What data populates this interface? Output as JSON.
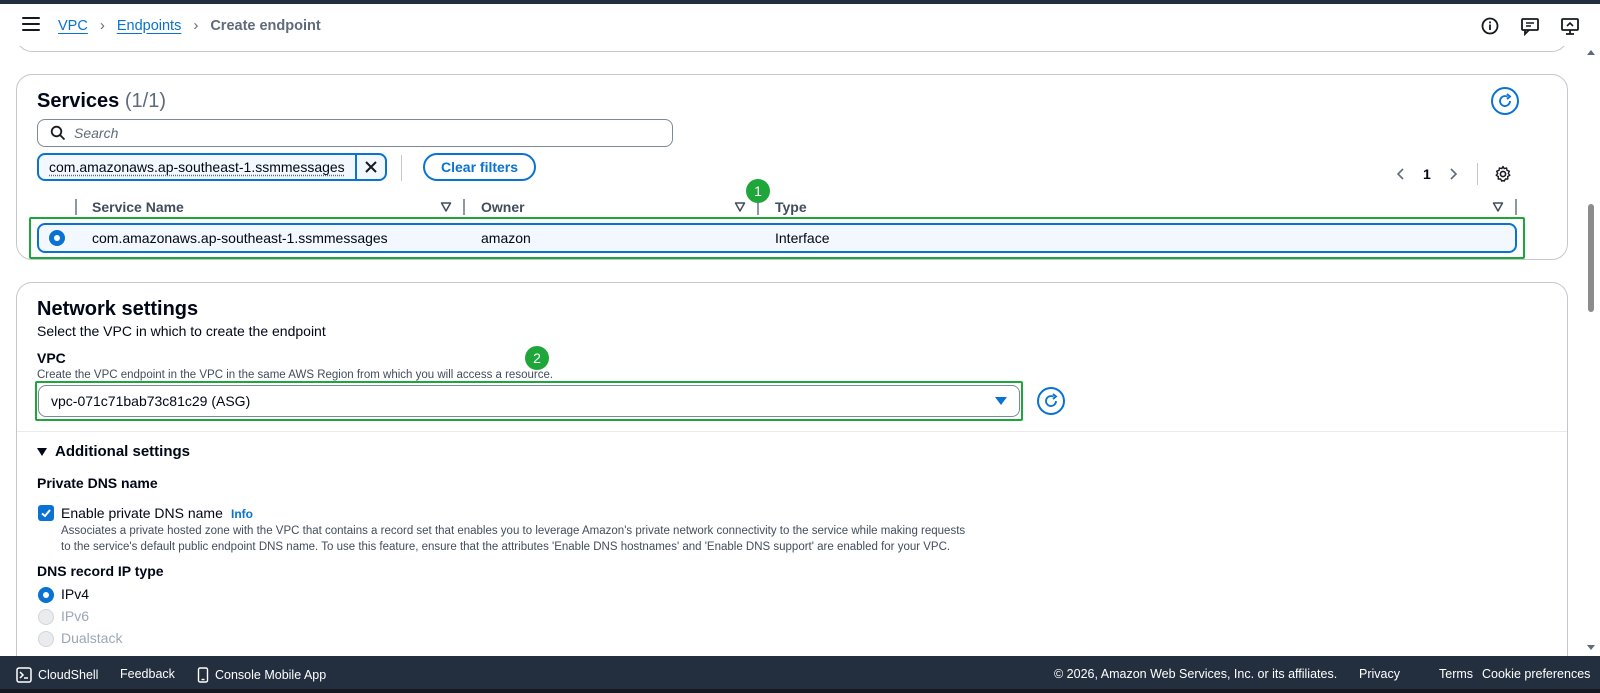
{
  "breadcrumb": {
    "items": [
      "VPC",
      "Endpoints"
    ],
    "current": "Create endpoint"
  },
  "services": {
    "title": "Services",
    "count": "(1/1)",
    "search_placeholder": "Search",
    "filter_token": "com.amazonaws.ap-southeast-1.ssmmessages",
    "clear_filters": "Clear filters",
    "page": "1",
    "columns": [
      "Service Name",
      "Owner",
      "Type"
    ],
    "rows": [
      {
        "service_name": "com.amazonaws.ap-southeast-1.ssmmessages",
        "owner": "amazon",
        "type": "Interface",
        "selected": true
      }
    ]
  },
  "annotations": [
    "1",
    "2"
  ],
  "network": {
    "title": "Network settings",
    "description": "Select the VPC in which to create the endpoint",
    "vpc_label": "VPC",
    "vpc_help": "Create the VPC endpoint in the VPC in the same AWS Region from which you will access a resource.",
    "vpc_value": "vpc-071c71bab73c81c29 (ASG)",
    "additional_settings": "Additional settings",
    "private_dns_label": "Private DNS name",
    "enable_dns_label": "Enable private DNS name",
    "enable_dns_checked": true,
    "info": "Info",
    "dns_desc_line1": "Associates a private hosted zone with the VPC that contains a record set that enables you to leverage Amazon's private network connectivity to the service while making requests",
    "dns_desc_line2": "to the service's default public endpoint DNS name. To use this feature, ensure that the attributes 'Enable DNS hostnames' and 'Enable DNS support' are enabled for your VPC.",
    "dns_record_label": "DNS record IP type",
    "ip_types": [
      {
        "label": "IPv4",
        "selected": true,
        "disabled": false
      },
      {
        "label": "IPv6",
        "selected": false,
        "disabled": true
      },
      {
        "label": "Dualstack",
        "selected": false,
        "disabled": true
      }
    ]
  },
  "footer": {
    "cloudshell": "CloudShell",
    "feedback": "Feedback",
    "mobile_app": "Console Mobile App",
    "copyright": "© 2026, Amazon Web Services, Inc. or its affiliates.",
    "privacy": "Privacy",
    "terms": "Terms",
    "cookie": "Cookie preferences"
  },
  "colors": {
    "link": "#0972d3",
    "annotation": "#1fa63b",
    "footer_bg": "#232f3e"
  }
}
